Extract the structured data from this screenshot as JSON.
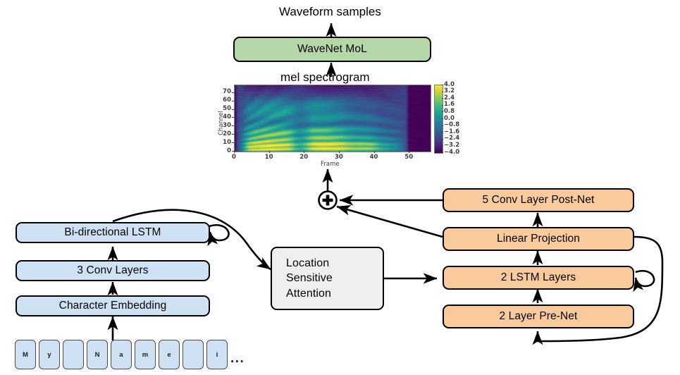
{
  "diagram": {
    "title_text": "Waveform samples",
    "mel_text": "mel spectrogram",
    "ellipsis": "...",
    "vocoder": {
      "label": "WaveNet MoL"
    },
    "sum_node": {
      "symbol": "+",
      "name": "summation"
    },
    "encoder": {
      "bilstm": "Bi-directional LSTM",
      "conv": "3 Conv Layers",
      "embedding": "Character Embedding",
      "characters": [
        "M",
        "y",
        "",
        "N",
        "a",
        "m",
        "e",
        "",
        "i"
      ]
    },
    "attention": {
      "line1": "Location",
      "line2": "Sensitive",
      "line3": "Attention"
    },
    "decoder": {
      "postnet": "5 Conv Layer Post-Net",
      "linear": "Linear Projection",
      "lstm": "2 LSTM Layers",
      "prenet": "2 Layer Pre-Net"
    },
    "colors": {
      "blue": "#cfe2f3",
      "orange": "#f9cb9c",
      "green": "#b6d7a8",
      "grey": "#efefef",
      "stroke": "#000000"
    }
  },
  "chart_data": {
    "type": "heatmap",
    "title": "mel spectrogram",
    "xlabel": "Frame",
    "ylabel": "Channel",
    "xlim": [
      0,
      56
    ],
    "ylim": [
      0,
      79
    ],
    "xticks": [
      0,
      10,
      20,
      30,
      40,
      50
    ],
    "yticks": [
      0,
      10,
      20,
      30,
      40,
      50,
      60,
      70
    ],
    "colormap": "viridis",
    "colorbar": {
      "vmin": -4.0,
      "vmax": 4.0,
      "ticks": [
        "4.0",
        "3.2",
        "2.4",
        "1.6",
        "0.8",
        "0.0",
        "−0.8",
        "−1.6",
        "−2.4",
        "−3.2",
        "−4.0"
      ]
    },
    "grid": false,
    "legend": "colorbar-right",
    "description": "80-channel mel spectrogram over 56 frames; bright harmonic bands of voiced speech from frames 3-47, silence at the edges."
  }
}
